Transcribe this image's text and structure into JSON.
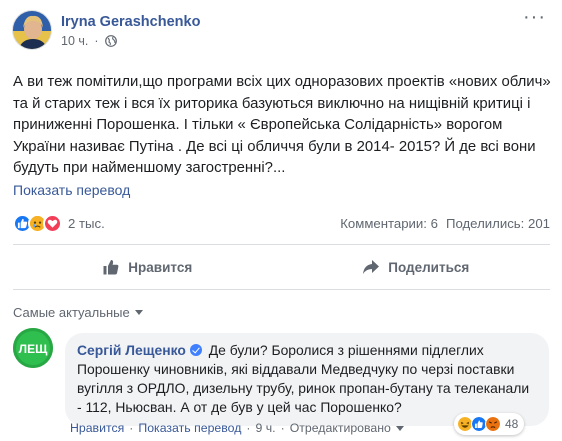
{
  "post": {
    "author": "Iryna Gerashchenko",
    "time": "10 ч.",
    "dot": "·",
    "more": "···",
    "text": "А ви теж помітили,що програми всіх цих одноразових проектів «нових облич» та й старих теж і вся їх риторика базуються виключно на нищівній критиці і приниженні Порошенка. І тільки « Європейська Солідарність» ворогом України називає Путіна . Де всі ці обличчя були в 2014- 2015? Й де всі вони будуть при найменшому загостренні?...",
    "see_translation": "Показать перевод"
  },
  "stats": {
    "reactions_count": "2 тыс.",
    "comments": "Комментарии: 6",
    "shares": "Поделились: 201"
  },
  "actions": {
    "like": "Нравится",
    "share": "Поделиться"
  },
  "sort": {
    "label": "Самые актуальные"
  },
  "comment": {
    "author": "Сергій Лещенко",
    "avatar_text": "ЛЕЩ",
    "text": "Де були? Боролися з рішеннями підлеглих Порошенку чиновників, які віддавали Медведчуку по черзі поставки вугілля з ОРДЛО, дизельну трубу, ринок пропан-бутану та телеканали - 112, Ньюсван. А от де був у цей час Порошенко?",
    "reactions_count": "48",
    "like": "Нравится",
    "translate": "Показать перевод",
    "time": "9 ч.",
    "edited": "Отредактировано",
    "dot": "·"
  },
  "colors": {
    "link": "#385898",
    "like_blue": "#1877f2",
    "love_red": "#f33e58",
    "sad_yellow": "#f7b125",
    "angry_orange": "#e9710f",
    "verified_blue": "#4080ff",
    "avatar_green": "#4caf50"
  },
  "icons": [
    "globe-icon",
    "like-icon",
    "share-icon",
    "sad-icon",
    "love-icon",
    "laugh-icon",
    "angry-icon",
    "verified-icon"
  ]
}
